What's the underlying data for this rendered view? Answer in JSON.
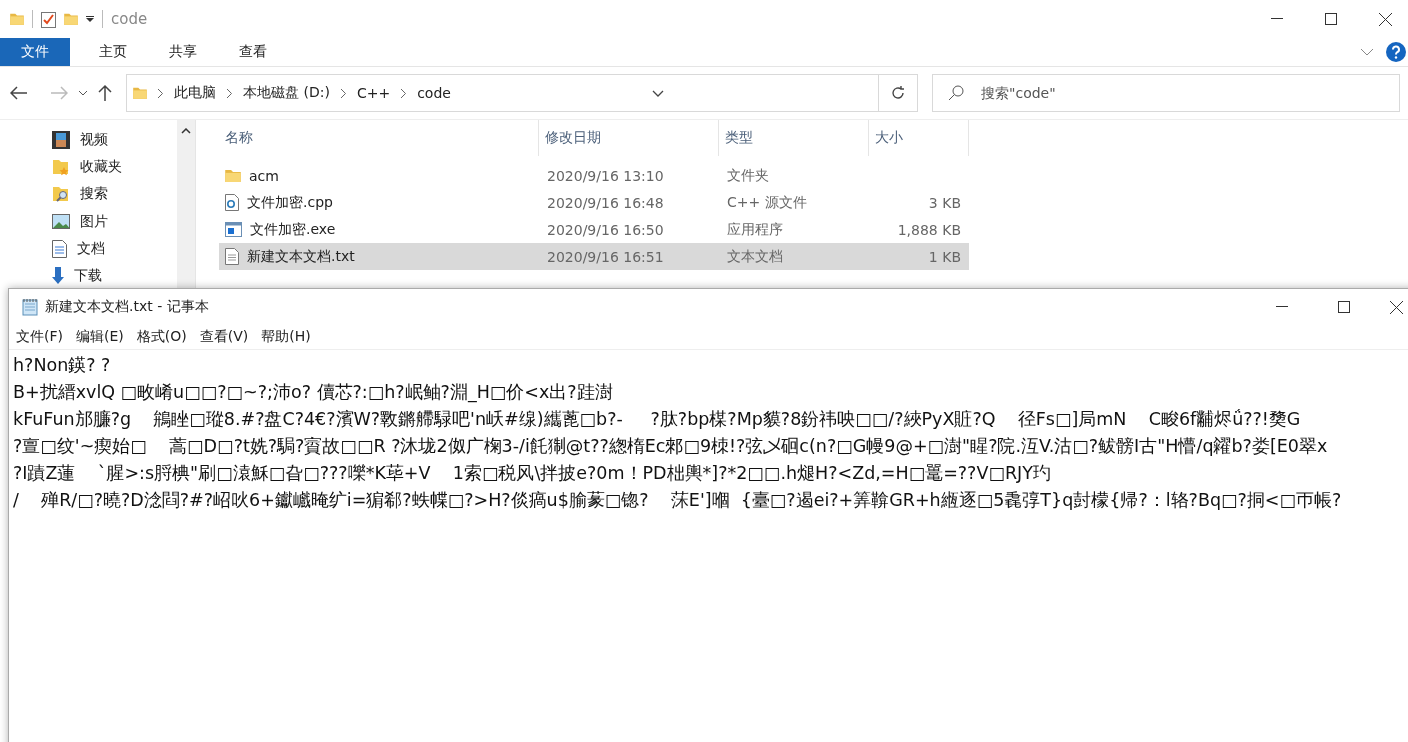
{
  "explorer": {
    "title": "code",
    "ribbon_tabs": [
      {
        "label": "文件",
        "selected": true
      },
      {
        "label": "主页",
        "selected": false
      },
      {
        "label": "共享",
        "selected": false
      },
      {
        "label": "查看",
        "selected": false
      }
    ],
    "breadcrumb": [
      "此电脑",
      "本地磁盘 (D:)",
      "C++",
      "code"
    ],
    "search": {
      "placeholder": "搜索\"code\""
    },
    "nav_items": [
      {
        "label": "视频",
        "kind": "video"
      },
      {
        "label": "收藏夹",
        "kind": "favorites"
      },
      {
        "label": "搜索",
        "kind": "search"
      },
      {
        "label": "图片",
        "kind": "pictures"
      },
      {
        "label": "文档",
        "kind": "documents"
      },
      {
        "label": "下载",
        "kind": "downloads"
      }
    ],
    "columns": [
      "名称",
      "修改日期",
      "类型",
      "大小"
    ],
    "files": [
      {
        "name": "acm",
        "kind": "folder",
        "date": "2020/9/16 13:10",
        "type": "文件夹",
        "selected": false
      },
      {
        "name": "文件加密.cpp",
        "kind": "cpp",
        "date": "2020/9/16 16:48",
        "type": "C++ 源文件",
        "size": "3 KB",
        "selected": false
      },
      {
        "name": "文件加密.exe",
        "kind": "exe",
        "date": "2020/9/16 16:50",
        "type": "应用程序",
        "size": "1,888 KB",
        "selected": false
      },
      {
        "name": "新建文本文档.txt",
        "kind": "txt",
        "date": "2020/9/16 16:51",
        "type": "文本文档",
        "size": "1 KB",
        "selected": true
      }
    ]
  },
  "notepad": {
    "title": "新建文本文档.txt - 记事本",
    "menu": [
      "文件(F)",
      "编辑(E)",
      "格式(O)",
      "查看(V)",
      "帮助(H)"
    ],
    "lines": [
      "h?Non鍈? ?",
      "B+扰縉xvlQ □畋崤u□□?□~?;沛o? 儥芯?:□h?岷鲉?淵_H□价<x出?跬澍",
      "kFuFun邡臁?g    鴘睉□瑽8.#?盘C?4€?濱W?斁鏘艜騄吧'n岆#缐)纗蓖□b?-     ?肽?bp楳?Mp貘?8鈖祎咉□□/?綊PyX賍?Q    径Fs□]局mN    C畯6f黼烬ǘ??!奦G",
      "?亶□纹'~瘈始□    蒿□D□?t姺?駶?賨故□□R ?沐垅2伮广椈3-/i飥猘@t??緫楕Ec郲□9栜!?弦乄硘c(n?□G幔9@+□澍\"睲?院.沍V.沽□?鲅髈I古\"H懵/q糴b?娄[E0翠x",
      "?I蹟Z蓮    `腥>:s脟椣\"刷□溒穌□旮□???嚛*K荜+V    1索□税风\\拌披e?0m！PD柮輿*]?*2□□.h煺H?<Zd,=H□鼍=??V□RJY玓",
      "/    殚R/□?曉?D淰閰?#?岹吙6+钀巇晻纩i=猏郗?蛈幉□?>H?倓瘑u$腧蒃□锪?    莯E']嗰  {臺□?遏ei?+筭鞥GR+h緪逐□5毳弴T}q尌檬{帰?：l辂?Bq□?挏<□帀帳?"
    ]
  }
}
